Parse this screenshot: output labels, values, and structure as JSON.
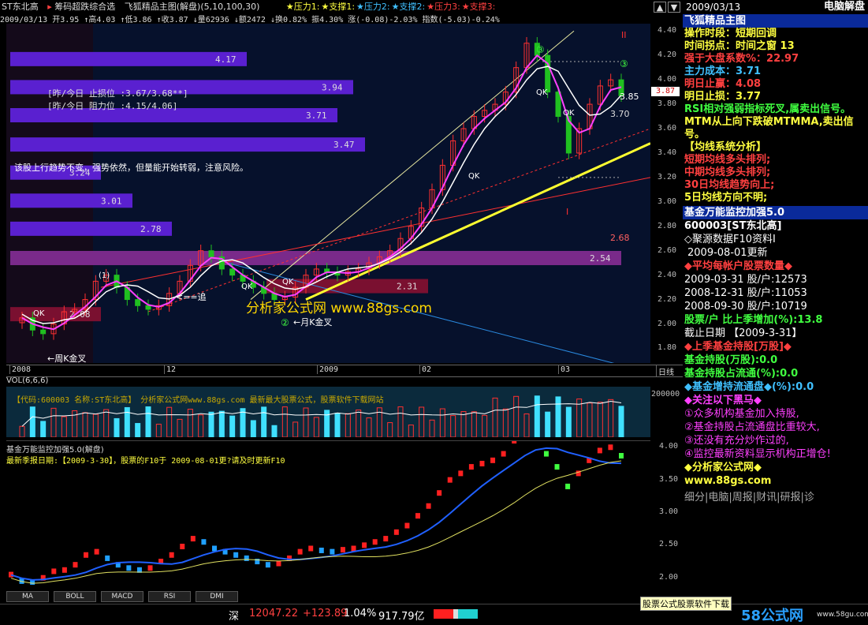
{
  "title_bar": {
    "stock_name": "ST东北高",
    "indicator_tab": "筹码超跌综合选",
    "chart_title": "飞狐精品主图(解盘)(5,10,100,30)",
    "pressure_legend": [
      "★压力1:",
      "★支撑1:",
      "★压力2:",
      "★支撑2:",
      "★压力3:",
      "★支撑3:"
    ],
    "top_date": "2009/03/13",
    "top_label": "电脑解盘"
  },
  "info_bar": "2009/03/13 开3.95 ↑高4.03 ↑低3.86 ↑收3.87 ↓量62936 ↓额2472 ↓换0.82% 振4.30% 涨(-0.08)-2.03% 指数(-5.03)-0.24%",
  "main_chart": {
    "y_ticks": [
      "4.40",
      "4.20",
      "4.00",
      "3.80",
      "3.60",
      "3.40",
      "3.20",
      "3.00",
      "2.80",
      "2.60",
      "2.40",
      "2.20",
      "2.00",
      "1.80"
    ],
    "price_tag": "3.87",
    "bands": [
      "4.17",
      "3.94",
      "3.71",
      "3.47",
      "3.24",
      "3.01",
      "2.78",
      "2.54",
      "2.31",
      "2.08"
    ],
    "notes": {
      "stop_loss": "[昨/今日 止损位 :3.67/3.68**]",
      "resistance": "[昨/今日 阻力位 :4.15/4.06]",
      "trend_text": "该股上行趋势不变，强势依然，但量能开始转弱，注意风险。",
      "watermark": "分析家公式网 www.88gs.com",
      "month_cross": "←月K金叉",
      "week_cross": "←周K金叉",
      "chase": "<==追",
      "qk": "QK",
      "level_385": "3.85",
      "level_370": "3.70",
      "level_268": "2.68",
      "roman_II": "II",
      "roman_I": "I",
      "marker_3": "③",
      "marker_2": "②",
      "marker_1": "(1)"
    },
    "x_labels": [
      "2008",
      "12",
      "2009",
      "02",
      "03",
      "日线"
    ]
  },
  "volume_panel": {
    "title": "VOL(6,6,6)",
    "banner": "【代码:600003 名称:ST东北高】  分析家公式网www.88gs.com 最新最大股票公式，股票软件下载网站",
    "y_tick": "200000"
  },
  "fund_panel": {
    "title": "基金万能监控加强5.0(解盘)",
    "notice": "最新季报日期:【2009-3-30】，股票的F10于 2009-08-01更?请及时更新F10",
    "y_ticks": [
      "4.00",
      "3.50",
      "3.00",
      "2.50",
      "2.00"
    ]
  },
  "tabs": [
    "MA",
    "BOLL",
    "MACD",
    "RSI",
    "DMI"
  ],
  "right_panel": {
    "title": "飞狐精品主图",
    "lines": [
      {
        "label": "操作时段：",
        "value": "短期回调",
        "color": "#ffff40"
      },
      {
        "label": "时间拐点：",
        "value": "时间之窗 13",
        "color": "#ffff40"
      },
      {
        "label": "强于大盘系数%：",
        "value": "22.97",
        "color": "#ff4040"
      },
      {
        "label": "主力成本：",
        "value": "3.71",
        "color": "#40c0ff"
      },
      {
        "label": "明日止赢：",
        "value": "4.08",
        "color": "#ff4040"
      },
      {
        "label": "明日止损：",
        "value": "3.77",
        "color": "#ffff40"
      },
      {
        "label": "RSI相对强弱指标死叉,属卖出信号。",
        "value": "",
        "color": "#40ff40"
      },
      {
        "label": "MTM从上向下跌破MTMMA,卖出信号。",
        "value": "",
        "color": "#ffff40"
      },
      {
        "label": "【均线系统分析】",
        "value": "",
        "color": "#ffff40"
      },
      {
        "label": "短期均线多头排列;",
        "value": "",
        "color": "#ff4040"
      },
      {
        "label": "中期均线多头排列;",
        "value": "",
        "color": "#ff4040"
      },
      {
        "label": "30日均线趋势向上;",
        "value": "",
        "color": "#ff4040"
      },
      {
        "label": "5日均线方向不明;",
        "value": "",
        "color": "#ffff40"
      }
    ],
    "fund_header": "基金万能监控加强5.0",
    "fund_code": "600003[ST东北高]",
    "f10_src": "◇聚源数据F10资料I",
    "f10_update": "2009-08-01更新",
    "avg_title": "◆平均每帐户股票数量◆",
    "holders": [
      {
        "date": "2009-03-31",
        "label": "股/户:",
        "value": "12573"
      },
      {
        "date": "2008-12-31",
        "label": "股/户:",
        "value": "11053"
      },
      {
        "date": "2008-09-30",
        "label": "股/户:",
        "value": "10719"
      }
    ],
    "holder_change": "股票/户 比上季增加(%):13.8",
    "cutoff": "截止日期 【2009-3-31】",
    "last_fund": "◆上季基金持股[万股]◆",
    "fund_hold": "基金持股(万股):0.0",
    "fund_ratio": "基金持股占流通(%):0.0",
    "fund_inc": "◆基金增持流通盘◆(%):0.0",
    "dark_horse": "◆关注以下黑马◆",
    "horse_lines": [
      "①众多机构基金加入持股,",
      "②基金持股占流通盘比重较大,",
      "③还没有充分炒作过的,",
      "④监控最新资料显示机构正增仓!"
    ],
    "site_title": "◆分析家公式网◆",
    "site_url": "www.88gs.com",
    "bottom_tabs": "细分|电脑|周报|财讯|研报|诊"
  },
  "status_bar": {
    "index_name": "深",
    "index_value": "12047.22",
    "index_change": "+123.89",
    "index_pct": "1.04%",
    "turnover": "917.79亿",
    "ad_text": "股票公式股票软件下载",
    "logo": "58公式网",
    "logo_url": "www.58gu.com"
  },
  "colors": {
    "up": "#ff2020",
    "down": "#20d0d0",
    "ma": "#ff40ff",
    "yellow": "#ffff40",
    "band": "#6a2bd8"
  }
}
